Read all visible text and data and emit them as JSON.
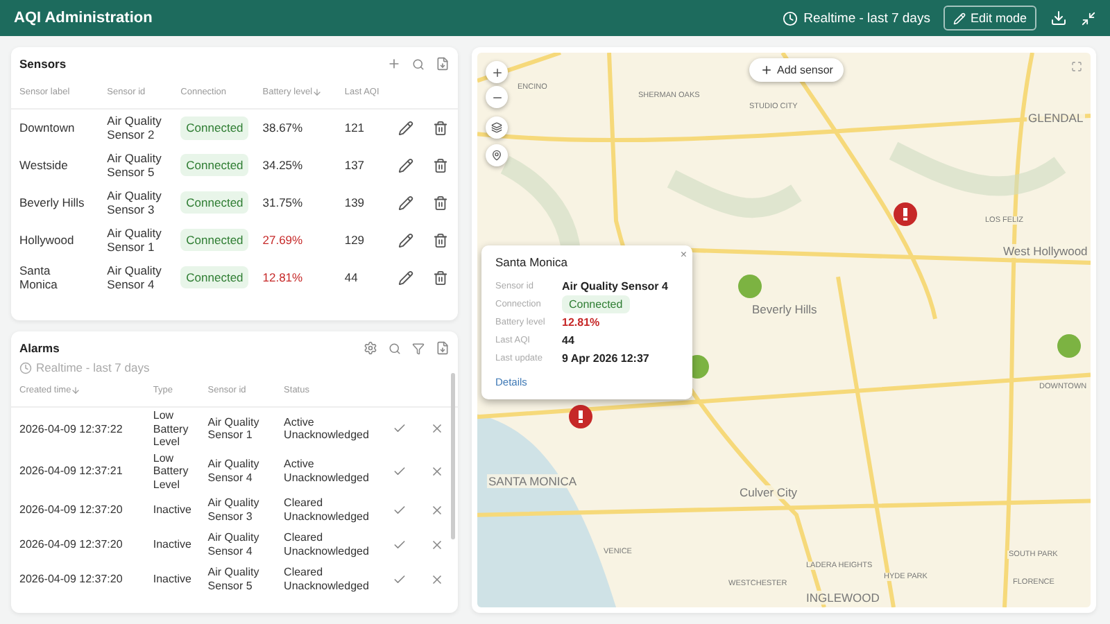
{
  "header": {
    "title": "AQI Administration",
    "timewindow": "Realtime - last 7 days",
    "edit_button": "Edit mode"
  },
  "sensors": {
    "title": "Sensors",
    "columns": [
      {
        "label": "Sensor label",
        "sorted": false
      },
      {
        "label": "Sensor id",
        "sorted": false
      },
      {
        "label": "Connection",
        "sorted": false
      },
      {
        "label": "Battery level",
        "sorted": true
      },
      {
        "label": "Last AQI",
        "sorted": false
      }
    ],
    "rows": [
      {
        "label": "Downtown",
        "sensor_id": "Air Quality Sensor 2",
        "connection": "Connected",
        "connected": true,
        "battery": "38.67%",
        "battery_low": false,
        "aqi": "121"
      },
      {
        "label": "Westside",
        "sensor_id": "Air Quality Sensor 5",
        "connection": "Connected",
        "connected": true,
        "battery": "34.25%",
        "battery_low": false,
        "aqi": "137"
      },
      {
        "label": "Beverly Hills",
        "sensor_id": "Air Quality Sensor 3",
        "connection": "Connected",
        "connected": true,
        "battery": "31.75%",
        "battery_low": false,
        "aqi": "139"
      },
      {
        "label": "Hollywood",
        "sensor_id": "Air Quality Sensor 1",
        "connection": "Connected",
        "connected": true,
        "battery": "27.69%",
        "battery_low": true,
        "aqi": "129"
      },
      {
        "label": "Santa Monica",
        "sensor_id": "Air Quality Sensor 4",
        "connection": "Connected",
        "connected": true,
        "battery": "12.81%",
        "battery_low": true,
        "aqi": "44"
      }
    ]
  },
  "alarms": {
    "title": "Alarms",
    "timewindow": "Realtime - last 7 days",
    "columns": [
      {
        "label": "Created time",
        "sorted": true
      },
      {
        "label": "Type",
        "sorted": false
      },
      {
        "label": "Sensor id",
        "sorted": false
      },
      {
        "label": "Status",
        "sorted": false
      }
    ],
    "rows": [
      {
        "time": "2026-04-09 12:37:22",
        "type": "Low Battery Level",
        "sensor_id": "Air Quality Sensor 1",
        "status": "Active Unacknowledged"
      },
      {
        "time": "2026-04-09 12:37:21",
        "type": "Low Battery Level",
        "sensor_id": "Air Quality Sensor 4",
        "status": "Active Unacknowledged"
      },
      {
        "time": "2026-04-09 12:37:20",
        "type": "Inactive",
        "sensor_id": "Air Quality Sensor 3",
        "status": "Cleared Unacknowledged"
      },
      {
        "time": "2026-04-09 12:37:20",
        "type": "Inactive",
        "sensor_id": "Air Quality Sensor 4",
        "status": "Cleared Unacknowledged"
      },
      {
        "time": "2026-04-09 12:37:20",
        "type": "Inactive",
        "sensor_id": "Air Quality Sensor 5",
        "status": "Cleared Unacknowledged"
      }
    ]
  },
  "map": {
    "add_button": "Add sensor",
    "labels": [
      "ENCINO",
      "SHERMAN OAKS",
      "STUDIO CITY",
      "GLENDAL",
      "LOS FELIZ",
      "West Hollywood",
      "Beverly Hills",
      "SANTA MONICA",
      "Culver City",
      "VENICE",
      "LADERA HEIGHTS",
      "HYDE PARK",
      "SOUTH PARK",
      "FLORENCE",
      "WESTCHESTER",
      "INGLEWOOD",
      "DOWNTOWN"
    ],
    "markers": [
      {
        "kind": "alarm",
        "color": "#c62828"
      },
      {
        "kind": "normal",
        "color": "#7cb342"
      },
      {
        "kind": "normal",
        "color": "#7cb342"
      },
      {
        "kind": "normal",
        "color": "#7cb342"
      },
      {
        "kind": "alarm",
        "color": "#c62828"
      }
    ],
    "popup": {
      "title": "Santa Monica",
      "close": "×",
      "fields": [
        {
          "kind": "text",
          "label": "Sensor id",
          "value": "Air Quality Sensor 4"
        },
        {
          "kind": "chip",
          "label": "Connection",
          "value": "Connected",
          "connected": true
        },
        {
          "kind": "text",
          "label": "Battery level",
          "value": "12.81%",
          "low": true
        },
        {
          "kind": "text",
          "label": "Last AQI",
          "value": "44"
        },
        {
          "kind": "text",
          "label": "Last update",
          "value": "9 Apr 2026 12:37"
        }
      ],
      "link": "Details"
    }
  }
}
